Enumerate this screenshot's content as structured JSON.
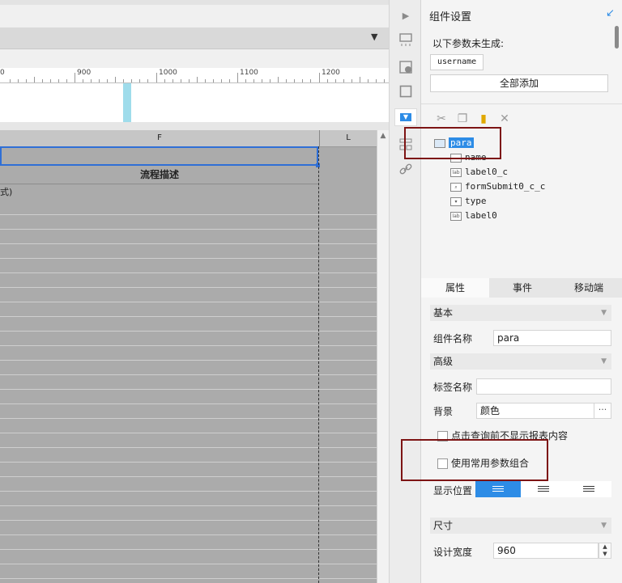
{
  "designer": {
    "ruler_ticks": [
      "900",
      "1000",
      "1100",
      "1200"
    ],
    "ruler_edge_fragment": "0",
    "columns": {
      "f": "F",
      "l": "L"
    },
    "header_cell": "流程描述",
    "cell_fragment": "式)"
  },
  "iconstrip": {
    "icons": [
      "collapse-icon",
      "layout-icon",
      "info-icon",
      "frame-icon",
      "dropdown-icon",
      "tree-icon",
      "link-icon"
    ]
  },
  "panel": {
    "title": "组件设置",
    "params_label": "以下参数未生成:",
    "param_chip": "username",
    "add_all": "全部添加",
    "tree": {
      "root": "para",
      "children": [
        "name",
        "label0_c",
        "formSubmit0_c_c",
        "type",
        "label0"
      ],
      "icon_text": "lab"
    },
    "tabs": [
      "属性",
      "事件",
      "移动端"
    ],
    "sections": {
      "basic": "基本",
      "advanced": "高级",
      "size": "尺寸"
    },
    "fields": {
      "component_name_label": "组件名称",
      "component_name_value": "para",
      "tag_name_label": "标签名称",
      "tag_name_value": "",
      "background_label": "背景",
      "background_value": "颜色",
      "more_button": "···",
      "check_hide_label": "点击查询前不显示报表内容",
      "check_common_label": "使用常用参数组合",
      "position_label": "显示位置",
      "design_width_label": "设计宽度",
      "design_width_value": "960"
    }
  },
  "colors": {
    "accent": "#2d8ce6",
    "selection": "#2f6fd6",
    "annotation": "#7d1414",
    "sheet_bg": "#ababab"
  }
}
